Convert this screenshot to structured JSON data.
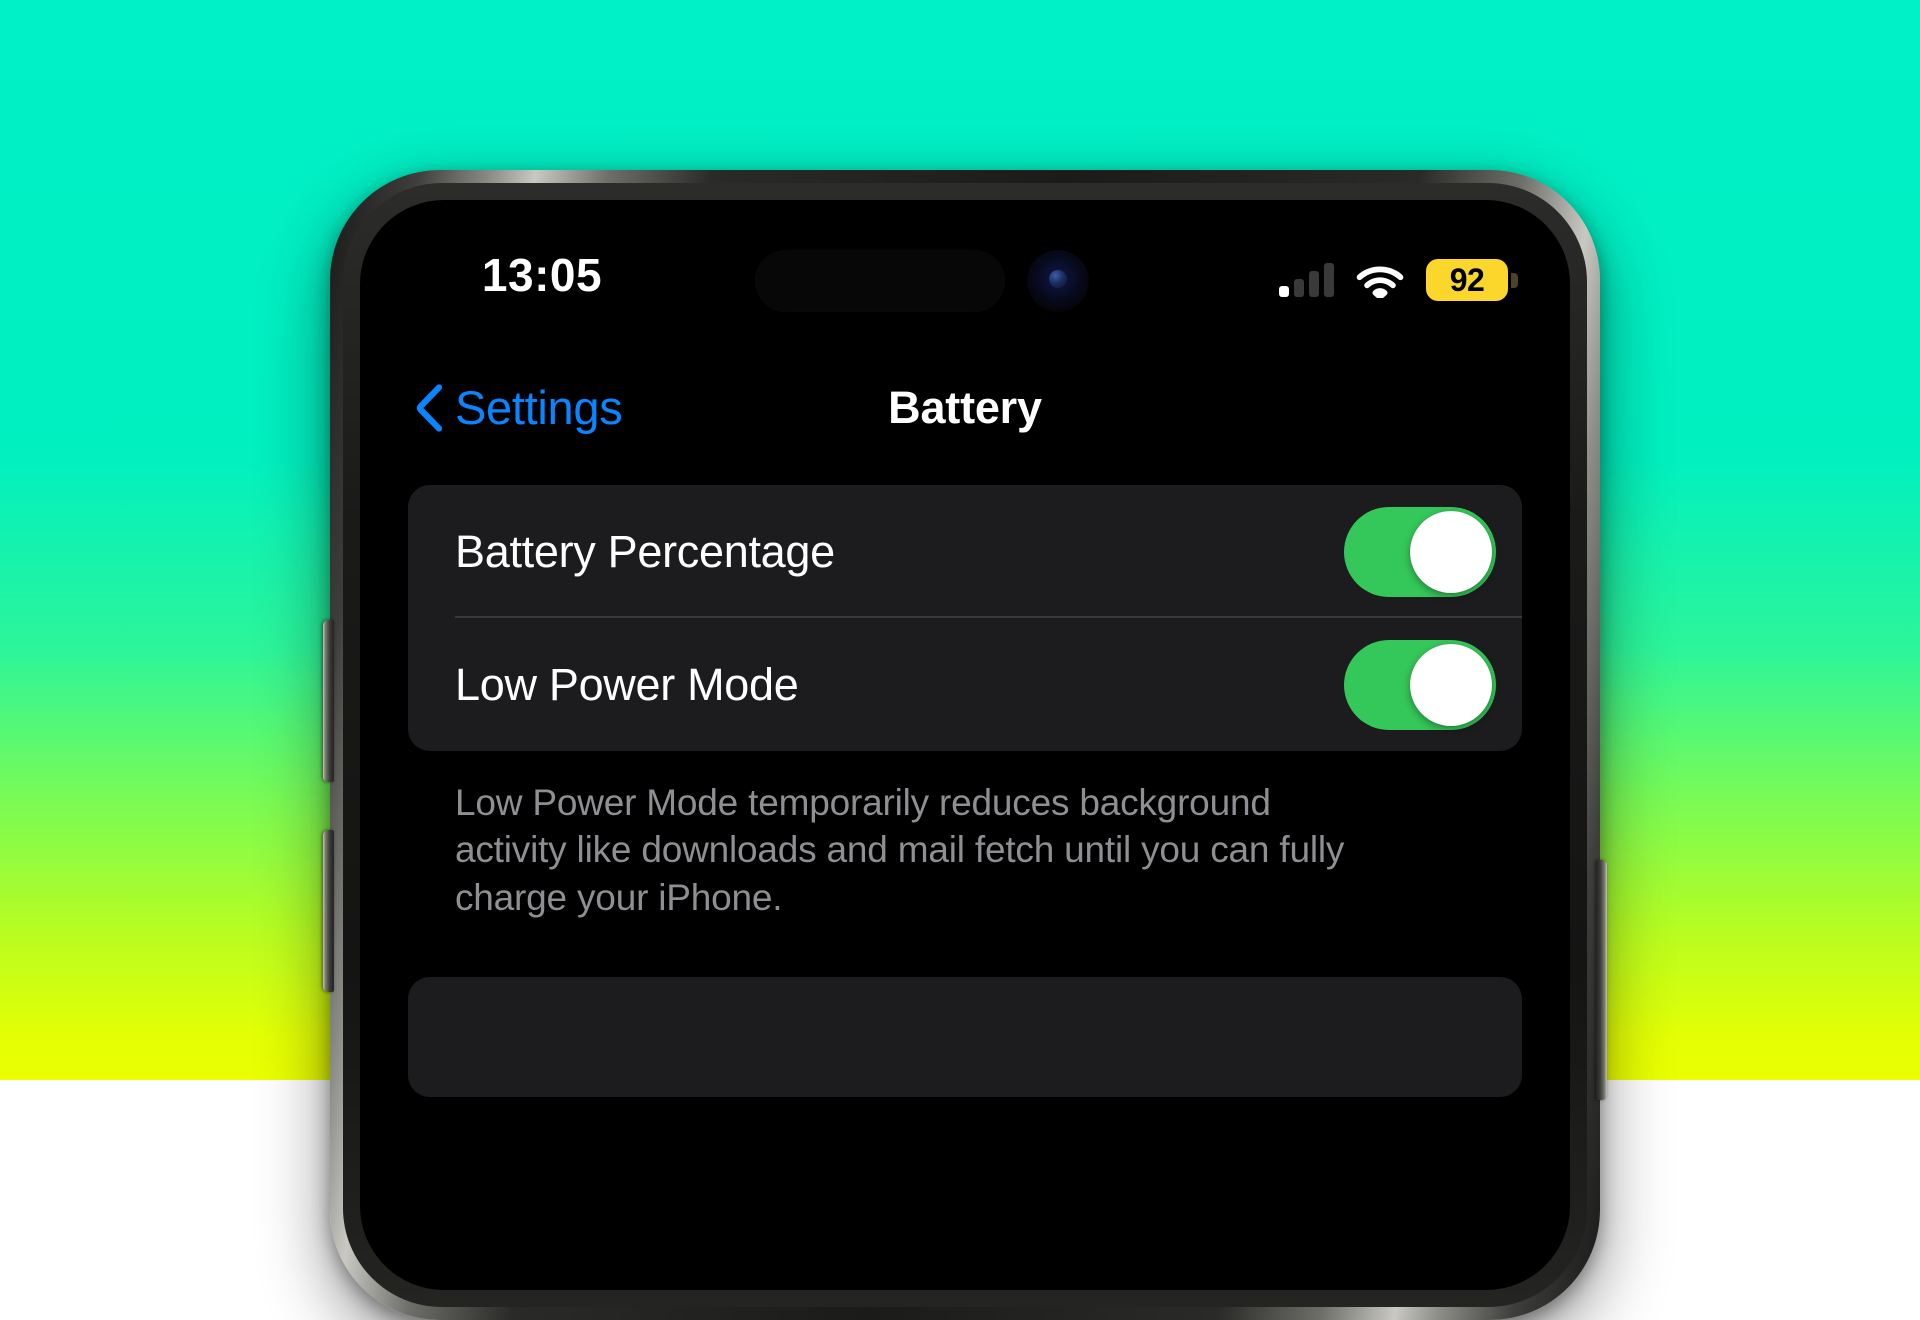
{
  "background": {
    "gradient_top": "#00F0C8",
    "gradient_bottom": "#EAFF00"
  },
  "status_bar": {
    "time": "13:05",
    "signal": {
      "icon": "cellular-signal-icon",
      "bars_total": 4,
      "bars_lit": 1
    },
    "wifi": {
      "icon": "wifi-icon",
      "strength": "full"
    },
    "battery": {
      "icon": "battery-icon",
      "percent": "92",
      "fill_color": "#FCD72B",
      "low_power_mode": true
    }
  },
  "nav_bar": {
    "back_icon": "chevron-left-icon",
    "back_label": "Settings",
    "title": "Battery"
  },
  "settings": {
    "rows": [
      {
        "label": "Battery Percentage",
        "control": "toggle",
        "value": "on"
      },
      {
        "label": "Low Power Mode",
        "control": "toggle",
        "value": "on"
      }
    ],
    "footer_note": "Low Power Mode temporarily reduces background activity like downloads and mail fetch until you can fully charge your iPhone.",
    "toggle_on_color": "#34C759",
    "accent_color": "#0A84FF"
  },
  "device": {
    "name": "iphone-device-frame",
    "buttons": [
      "volume-up-button",
      "volume-down-button",
      "power-button"
    ],
    "dynamic_island": "dynamic-island",
    "front_camera": "front-camera"
  }
}
